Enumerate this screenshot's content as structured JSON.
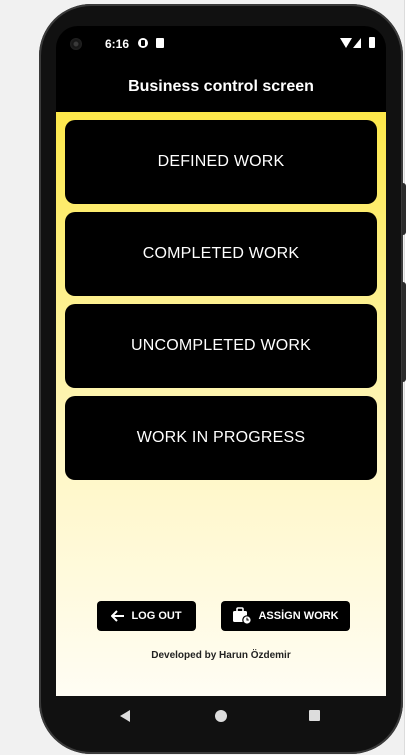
{
  "status_bar": {
    "time": "6:16",
    "icons": [
      "camera-icon",
      "notification-icon",
      "sd-card-icon",
      "wifi-icon",
      "signal-icon",
      "battery-icon"
    ]
  },
  "app_bar": {
    "title": "Business control screen"
  },
  "menu": {
    "items": [
      {
        "label": "DEFINED WORK"
      },
      {
        "label": "COMPLETED WORK"
      },
      {
        "label": "UNCOMPLETED WORK"
      },
      {
        "label": "WORK IN PROGRESS"
      }
    ]
  },
  "actions": {
    "logout_label": "LOG OUT",
    "assign_label": "ASSİGN WORK"
  },
  "footer": {
    "developer": "Developed by Harun Özdemir"
  },
  "colors": {
    "accent_yellow": "#fde84a",
    "card_black": "#000000"
  },
  "nav": {
    "icons": [
      "back-icon",
      "home-icon",
      "recents-icon"
    ]
  }
}
